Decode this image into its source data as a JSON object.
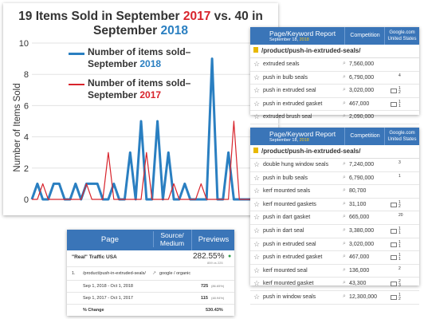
{
  "chart": {
    "title_part1": "19 Items Sold in September ",
    "title_year1": "2017",
    "title_part2": " vs. 40 in September ",
    "title_year2": "2018",
    "ylabel": "Number of Items Sold",
    "legend_2018_line1": "Number of items sold–",
    "legend_2018_line2a": "September ",
    "legend_2018_line2b": "2018",
    "legend_2017_line1": "Number of items sold–",
    "legend_2017_line2a": "September ",
    "legend_2017_line2b": "2017",
    "color_2018": "#2a7fc1",
    "color_2017": "#d8242c"
  },
  "chart_data": {
    "type": "line",
    "title": "19 Items Sold in September 2017 vs. 40 in September 2018",
    "ylabel": "Number of Items Sold",
    "xlabel": "",
    "ylim": [
      0,
      10
    ],
    "yticks": [
      0,
      2,
      4,
      6,
      8,
      10
    ],
    "x": [
      1,
      2,
      3,
      4,
      5,
      6,
      7,
      8,
      9,
      10,
      11,
      12,
      13,
      14,
      15,
      16,
      17,
      18,
      19,
      20,
      21,
      22,
      23,
      24,
      25,
      26,
      27,
      28,
      29,
      30,
      31,
      32,
      33,
      34,
      35,
      36,
      37,
      38,
      39,
      40,
      41
    ],
    "series": [
      {
        "name": "Number of items sold–September 2018",
        "color": "#2a7fc1",
        "values": [
          0,
          1,
          0,
          0,
          1,
          1,
          0,
          0,
          1,
          0,
          1,
          1,
          1,
          0,
          0,
          1,
          0,
          0,
          3,
          0,
          5,
          0,
          0,
          5,
          0,
          3,
          0,
          0,
          1,
          0,
          0,
          0,
          0,
          9,
          0,
          0,
          3,
          0,
          0,
          0,
          0
        ]
      },
      {
        "name": "Number of items sold–September 2017",
        "color": "#d8242c",
        "values": [
          0,
          0,
          1,
          0,
          0,
          0,
          0,
          0,
          0,
          0,
          1,
          0,
          0,
          0,
          3,
          0,
          0,
          0,
          0,
          0,
          0,
          3,
          0,
          0,
          0,
          0,
          1,
          0,
          0,
          0,
          0,
          1,
          0,
          0,
          0,
          0,
          0,
          5,
          0,
          0,
          0
        ]
      }
    ]
  },
  "report1": {
    "title": "Page/Keyword Report",
    "date_a": "September 18, ",
    "date_b": "2018",
    "col_competition": "Competition",
    "col_google_1": "Google.com",
    "col_google_2": "United States",
    "url": "/product/push-in-extruded-seals/",
    "rows": [
      {
        "kw": "extruded seals",
        "vol": "7,560,000",
        "g1": "",
        "g2": ""
      },
      {
        "kw": "push in bulb seals",
        "vol": "6,790,000",
        "g1": "4",
        "g2": ""
      },
      {
        "kw": "push in extruded seal",
        "vol": "3,020,000",
        "g1": "1",
        "g2": "2"
      },
      {
        "kw": "push in extruded gasket",
        "vol": "467,000",
        "g1": "1",
        "g2": "1"
      },
      {
        "kw": "extruded brush seal",
        "vol": "2,090,000",
        "g1": "",
        "g2": ""
      }
    ]
  },
  "report2": {
    "title": "Page/Keyword Report",
    "date_a": "September 18, ",
    "date_b": "2018",
    "col_competition": "Competition",
    "col_google_1": "Google.com",
    "col_google_2": "United States",
    "url": "/product/push-in-extruded-seals/",
    "rows": [
      {
        "kw": "double hung window seals",
        "vol": "7,240,000",
        "g1": "3",
        "g2": ""
      },
      {
        "kw": "push in bulb seals",
        "vol": "6,790,000",
        "g1": "1",
        "g2": ""
      },
      {
        "kw": "kerf mounted seals",
        "vol": "80,700",
        "g1": "",
        "g2": ""
      },
      {
        "kw": "kerf mounted gaskets",
        "vol": "31,100",
        "g1": "1",
        "g2": "2"
      },
      {
        "kw": "push in dart gasket",
        "vol": "665,000",
        "g1": "20",
        "g2": ""
      },
      {
        "kw": "push in dart seal",
        "vol": "3,380,000",
        "g1": "1",
        "g2": "1"
      },
      {
        "kw": "push in extruded seal",
        "vol": "3,020,000",
        "g1": "1",
        "g2": "1"
      },
      {
        "kw": "push in extruded gasket",
        "vol": "467,000",
        "g1": "1",
        "g2": "1"
      },
      {
        "kw": "kerf mounted seal",
        "vol": "136,000",
        "g1": "2",
        "g2": ""
      },
      {
        "kw": "kerf mounted gasket",
        "vol": "43,300",
        "g1": "2",
        "g2": "3"
      },
      {
        "kw": "push in window seals",
        "vol": "12,300,000",
        "g1": "1",
        "g2": "2"
      }
    ]
  },
  "ga": {
    "col_page": "Page",
    "col_source_1": "Source/",
    "col_source_2": "Medium",
    "col_previews": "Previews",
    "segment": "\"Real\" Traffic USA",
    "pct_total": "282.55%",
    "pct_sub": "859 vs 225",
    "row_num": "1.",
    "row_page": "/product/push-in-extruded-seals/",
    "row_source": "google / organic",
    "r1_label": "Sep 1, 2018 - Oct 1, 2018",
    "r1_val": "725",
    "r1_pct": "(86.65%)",
    "r2_label": "Sep 1, 2017 - Oct 1, 2017",
    "r2_val": "115",
    "r2_pct": "(48.94%)",
    "r3_label": "% Change",
    "r3_val": "530.43%"
  }
}
